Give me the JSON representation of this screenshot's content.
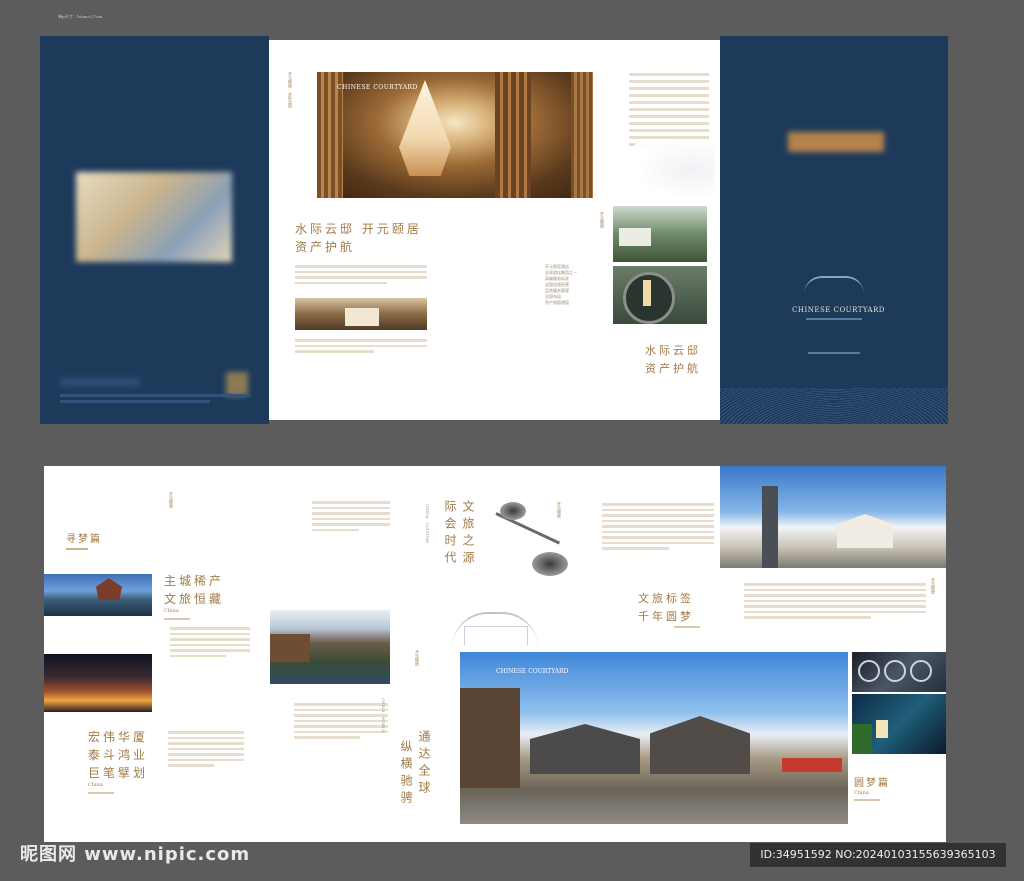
{
  "spec_note": "单p尺寸：16cm×27cm",
  "top": {
    "title_left": "水际云邸  开元颐居",
    "title_left_2": "资产护航",
    "title_right_1": "水际云邸",
    "title_right_2": "资产护航",
    "photo_overlay": "CHINESE COURTYARD",
    "cover_brand": "CHINESE COURTYARD",
    "bullets": [
      "开元颐居酒店",
      "全球酒店集团之一",
      "高端服务标准",
      "全国连锁经营",
      "品质服务管理",
      "全国布局",
      "资产保值增值"
    ]
  },
  "bottom": {
    "xunmeng": "寻梦篇",
    "zhucheng_1": "主城稀产",
    "zhucheng_2": "文旅恒藏",
    "china_1": "China",
    "hongwei_1": "宏伟华厦",
    "hongwei_2": "泰斗鸿业",
    "hongwei_3": "巨笔擘划",
    "china_2": "China",
    "wenlv_col1": "文旅之源",
    "wenlv_col2": "际会时代",
    "tongda_col1": "通达全球",
    "tongda_col2": "纵横驰骋",
    "wenlv_biaoqian_1": "文旅标签",
    "wenlv_biaoqian_2": "千年圆梦",
    "photo_overlay_2": "CHINESE COURTYARD",
    "yuanmeng": "圆梦篇",
    "china_3": "China"
  },
  "watermark": {
    "logo": "昵图网 www.nipic.com",
    "id": "ID:34951592 NO:20240103155639365103"
  }
}
